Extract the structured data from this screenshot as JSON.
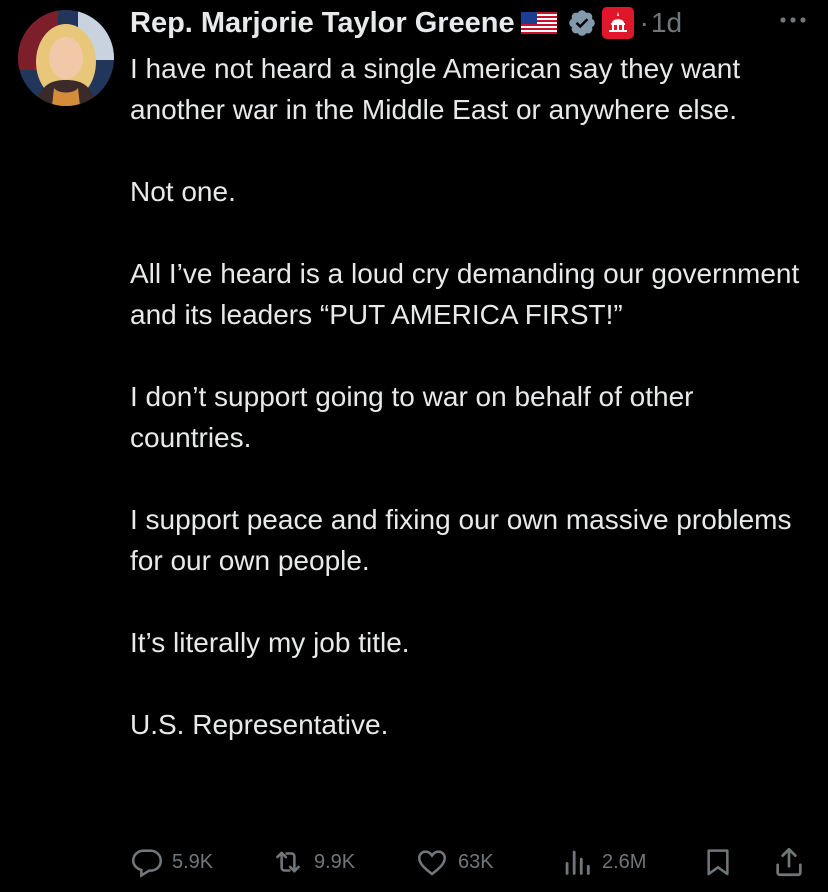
{
  "post": {
    "author_name": "Rep. Marjorie Taylor Greene",
    "time": "1d",
    "separator": "·",
    "paragraphs": [
      "I have not heard a single American say they want another war in the Middle East or anywhere else.",
      "Not one.",
      "All I’ve heard is a loud cry demanding our government and its leaders “PUT AMERICA FIRST!”",
      "I don’t support going to war on behalf of other countries.",
      "I support peace and fixing our own massive problems for our own people.",
      "It’s literally my job title.",
      "U.S. Representative."
    ]
  },
  "actions": {
    "replies": "5.9K",
    "reposts": "9.9K",
    "likes": "63K",
    "views": "2.6M"
  },
  "colors": {
    "background": "#000000",
    "text": "#e7e9ea",
    "muted": "#71767b",
    "verified": "#829aab",
    "affiliate_badge": "#e0162b"
  },
  "icons": [
    "us-flag-icon",
    "verified-badge-icon",
    "capitol-affiliate-icon",
    "more-icon",
    "reply-icon",
    "repost-icon",
    "like-icon",
    "views-icon",
    "bookmark-icon",
    "share-icon"
  ]
}
